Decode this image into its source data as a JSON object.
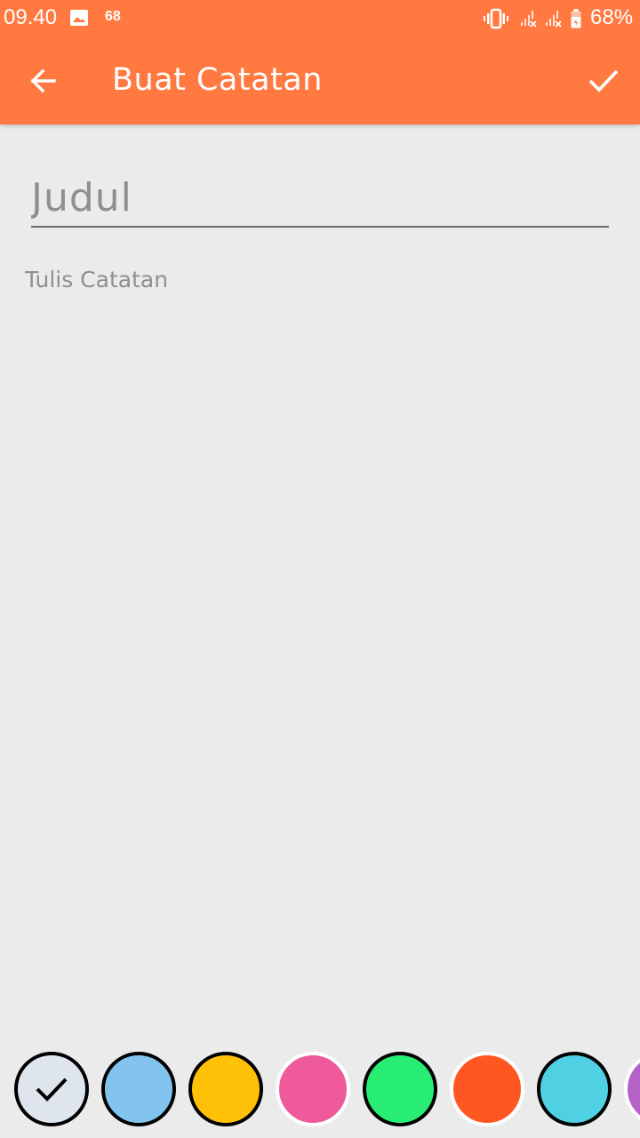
{
  "status_bar": {
    "time": "09.40",
    "notification_count": "68",
    "battery_percent": "68%"
  },
  "app_bar": {
    "title": "Buat Catatan",
    "back_icon": "arrow-left-icon",
    "save_icon": "check-icon"
  },
  "editor": {
    "title_placeholder": "Judul",
    "title_value": "",
    "body_placeholder": "Tulis Catatan",
    "body_value": ""
  },
  "colors": [
    {
      "name": "light-gray",
      "hex": "#dfe5ec",
      "selected": true,
      "border": "#000000"
    },
    {
      "name": "light-blue",
      "hex": "#82c4ee",
      "selected": false,
      "border": "#000000"
    },
    {
      "name": "amber",
      "hex": "#ffc107",
      "selected": false,
      "border": "#000000"
    },
    {
      "name": "pink",
      "hex": "#ee5a9a",
      "selected": false,
      "border": "#ffffff"
    },
    {
      "name": "green",
      "hex": "#27ed73",
      "selected": false,
      "border": "#000000"
    },
    {
      "name": "deep-orange",
      "hex": "#ff5722",
      "selected": false,
      "border": "#ffffff"
    },
    {
      "name": "cyan",
      "hex": "#4fd0e3",
      "selected": false,
      "border": "#000000"
    },
    {
      "name": "purple",
      "hex": "#b561c8",
      "selected": false,
      "border": "#ffffff"
    }
  ],
  "theme": {
    "accent": "#ff7940",
    "background": "#ebebeb"
  }
}
